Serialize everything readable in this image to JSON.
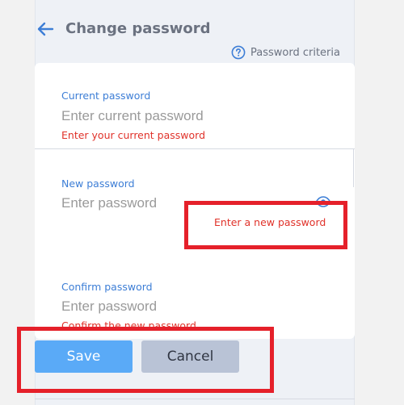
{
  "header": {
    "title": "Change password",
    "criteria_link": "Password criteria"
  },
  "form": {
    "current": {
      "label": "Current password",
      "placeholder": "Enter current password",
      "value": "",
      "error": "Enter your current password"
    },
    "new": {
      "label": "New password",
      "placeholder": "Enter password",
      "value": "",
      "error": "Enter a new password"
    },
    "confirm": {
      "label": "Confirm password",
      "placeholder": "Enter password",
      "value": "",
      "error": "Confirm the new password"
    }
  },
  "actions": {
    "save_label": "Save",
    "cancel_label": "Cancel"
  },
  "icons": {
    "back": "arrow-left-icon",
    "help": "question-circle-icon",
    "visibility": "eye-icon"
  },
  "colors": {
    "accent": "#3d7ed6",
    "error": "#e0322a",
    "save_button": "#5aaaf7",
    "cancel_button": "#b9c3d6",
    "highlight": "#e5202a"
  }
}
